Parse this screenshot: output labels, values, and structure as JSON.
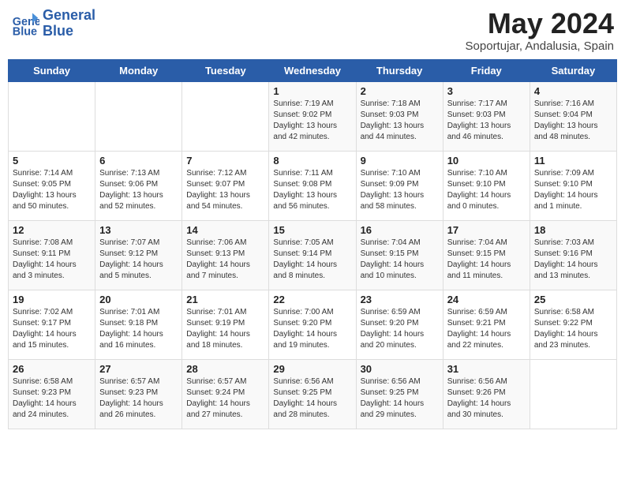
{
  "header": {
    "logo_line1": "General",
    "logo_line2": "Blue",
    "month_title": "May 2024",
    "subtitle": "Soportujar, Andalusia, Spain"
  },
  "weekdays": [
    "Sunday",
    "Monday",
    "Tuesday",
    "Wednesday",
    "Thursday",
    "Friday",
    "Saturday"
  ],
  "weeks": [
    [
      {
        "day": "",
        "info": ""
      },
      {
        "day": "",
        "info": ""
      },
      {
        "day": "",
        "info": ""
      },
      {
        "day": "1",
        "info": "Sunrise: 7:19 AM\nSunset: 9:02 PM\nDaylight: 13 hours\nand 42 minutes."
      },
      {
        "day": "2",
        "info": "Sunrise: 7:18 AM\nSunset: 9:03 PM\nDaylight: 13 hours\nand 44 minutes."
      },
      {
        "day": "3",
        "info": "Sunrise: 7:17 AM\nSunset: 9:03 PM\nDaylight: 13 hours\nand 46 minutes."
      },
      {
        "day": "4",
        "info": "Sunrise: 7:16 AM\nSunset: 9:04 PM\nDaylight: 13 hours\nand 48 minutes."
      }
    ],
    [
      {
        "day": "5",
        "info": "Sunrise: 7:14 AM\nSunset: 9:05 PM\nDaylight: 13 hours\nand 50 minutes."
      },
      {
        "day": "6",
        "info": "Sunrise: 7:13 AM\nSunset: 9:06 PM\nDaylight: 13 hours\nand 52 minutes."
      },
      {
        "day": "7",
        "info": "Sunrise: 7:12 AM\nSunset: 9:07 PM\nDaylight: 13 hours\nand 54 minutes."
      },
      {
        "day": "8",
        "info": "Sunrise: 7:11 AM\nSunset: 9:08 PM\nDaylight: 13 hours\nand 56 minutes."
      },
      {
        "day": "9",
        "info": "Sunrise: 7:10 AM\nSunset: 9:09 PM\nDaylight: 13 hours\nand 58 minutes."
      },
      {
        "day": "10",
        "info": "Sunrise: 7:10 AM\nSunset: 9:10 PM\nDaylight: 14 hours\nand 0 minutes."
      },
      {
        "day": "11",
        "info": "Sunrise: 7:09 AM\nSunset: 9:10 PM\nDaylight: 14 hours\nand 1 minute."
      }
    ],
    [
      {
        "day": "12",
        "info": "Sunrise: 7:08 AM\nSunset: 9:11 PM\nDaylight: 14 hours\nand 3 minutes."
      },
      {
        "day": "13",
        "info": "Sunrise: 7:07 AM\nSunset: 9:12 PM\nDaylight: 14 hours\nand 5 minutes."
      },
      {
        "day": "14",
        "info": "Sunrise: 7:06 AM\nSunset: 9:13 PM\nDaylight: 14 hours\nand 7 minutes."
      },
      {
        "day": "15",
        "info": "Sunrise: 7:05 AM\nSunset: 9:14 PM\nDaylight: 14 hours\nand 8 minutes."
      },
      {
        "day": "16",
        "info": "Sunrise: 7:04 AM\nSunset: 9:15 PM\nDaylight: 14 hours\nand 10 minutes."
      },
      {
        "day": "17",
        "info": "Sunrise: 7:04 AM\nSunset: 9:15 PM\nDaylight: 14 hours\nand 11 minutes."
      },
      {
        "day": "18",
        "info": "Sunrise: 7:03 AM\nSunset: 9:16 PM\nDaylight: 14 hours\nand 13 minutes."
      }
    ],
    [
      {
        "day": "19",
        "info": "Sunrise: 7:02 AM\nSunset: 9:17 PM\nDaylight: 14 hours\nand 15 minutes."
      },
      {
        "day": "20",
        "info": "Sunrise: 7:01 AM\nSunset: 9:18 PM\nDaylight: 14 hours\nand 16 minutes."
      },
      {
        "day": "21",
        "info": "Sunrise: 7:01 AM\nSunset: 9:19 PM\nDaylight: 14 hours\nand 18 minutes."
      },
      {
        "day": "22",
        "info": "Sunrise: 7:00 AM\nSunset: 9:20 PM\nDaylight: 14 hours\nand 19 minutes."
      },
      {
        "day": "23",
        "info": "Sunrise: 6:59 AM\nSunset: 9:20 PM\nDaylight: 14 hours\nand 20 minutes."
      },
      {
        "day": "24",
        "info": "Sunrise: 6:59 AM\nSunset: 9:21 PM\nDaylight: 14 hours\nand 22 minutes."
      },
      {
        "day": "25",
        "info": "Sunrise: 6:58 AM\nSunset: 9:22 PM\nDaylight: 14 hours\nand 23 minutes."
      }
    ],
    [
      {
        "day": "26",
        "info": "Sunrise: 6:58 AM\nSunset: 9:23 PM\nDaylight: 14 hours\nand 24 minutes."
      },
      {
        "day": "27",
        "info": "Sunrise: 6:57 AM\nSunset: 9:23 PM\nDaylight: 14 hours\nand 26 minutes."
      },
      {
        "day": "28",
        "info": "Sunrise: 6:57 AM\nSunset: 9:24 PM\nDaylight: 14 hours\nand 27 minutes."
      },
      {
        "day": "29",
        "info": "Sunrise: 6:56 AM\nSunset: 9:25 PM\nDaylight: 14 hours\nand 28 minutes."
      },
      {
        "day": "30",
        "info": "Sunrise: 6:56 AM\nSunset: 9:25 PM\nDaylight: 14 hours\nand 29 minutes."
      },
      {
        "day": "31",
        "info": "Sunrise: 6:56 AM\nSunset: 9:26 PM\nDaylight: 14 hours\nand 30 minutes."
      },
      {
        "day": "",
        "info": ""
      }
    ]
  ]
}
